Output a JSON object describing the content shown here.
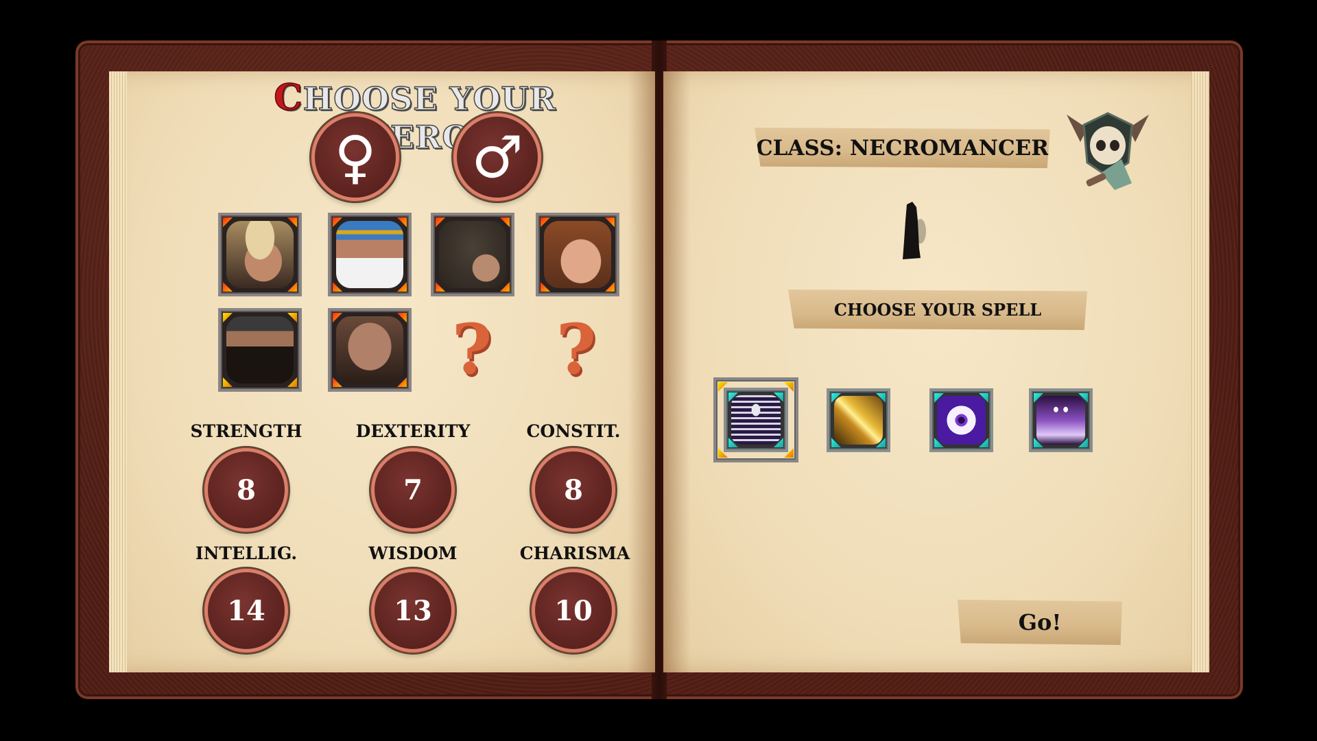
{
  "left_page": {
    "title_first_letter": "C",
    "title_rest": "HOOSE YOUR HERO",
    "gender_buttons": [
      {
        "id": "female",
        "icon": "female-symbol-icon",
        "glyph": "♀"
      },
      {
        "id": "male",
        "icon": "male-symbol-icon",
        "glyph": "♂"
      }
    ],
    "portraits": [
      {
        "description": "blond-haired young man",
        "state": "available",
        "corner_color": "#ff2a12"
      },
      {
        "description": "white-bearded old man with blue headband",
        "state": "available",
        "corner_color": "#ff2a12"
      },
      {
        "description": "hooded figure",
        "state": "available",
        "corner_color": "#ff2a12"
      },
      {
        "description": "curly red-haired youth",
        "state": "available",
        "corner_color": "#ff2a12"
      },
      {
        "description": "black-bearded man with dark headscarf",
        "state": "selected",
        "corner_color": "#ffe000"
      },
      {
        "description": "bald man",
        "state": "available",
        "corner_color": "#ff2a12"
      },
      {
        "description": "locked",
        "state": "locked",
        "glyph": "?"
      },
      {
        "description": "locked",
        "state": "locked",
        "glyph": "?"
      }
    ],
    "stats": [
      {
        "label": "STRENGTH",
        "value": "8"
      },
      {
        "label": "DEXTERITY",
        "value": "7"
      },
      {
        "label": "CONSTIT.",
        "value": "8"
      },
      {
        "label": "INTELLIG.",
        "value": "14"
      },
      {
        "label": "WISDOM",
        "value": "13"
      },
      {
        "label": "CHARISMA",
        "value": "10"
      }
    ]
  },
  "right_page": {
    "class_label": "CLASS: NECROMANCER",
    "class_emblem": "skull-shield-emblem-icon",
    "spell_header": "CHOOSE YOUR SPELL",
    "spells": [
      {
        "name": "skeleton-summon",
        "icon": "skeleton-icon",
        "selected": true
      },
      {
        "name": "golden-bolt",
        "icon": "lightning-bolt-icon",
        "selected": false
      },
      {
        "name": "purple-eye",
        "icon": "eye-icon",
        "selected": false
      },
      {
        "name": "spectral-flames",
        "icon": "ghost-flame-icon",
        "selected": false
      }
    ],
    "go_label": "Go!"
  },
  "colors": {
    "button_fill": "#622622",
    "button_ring": "#d8806a",
    "title_accent": "#c4171b",
    "question_mark": "#d9643a",
    "selected_corner": "#ffe000",
    "spell_corner": "#30f0e0"
  }
}
